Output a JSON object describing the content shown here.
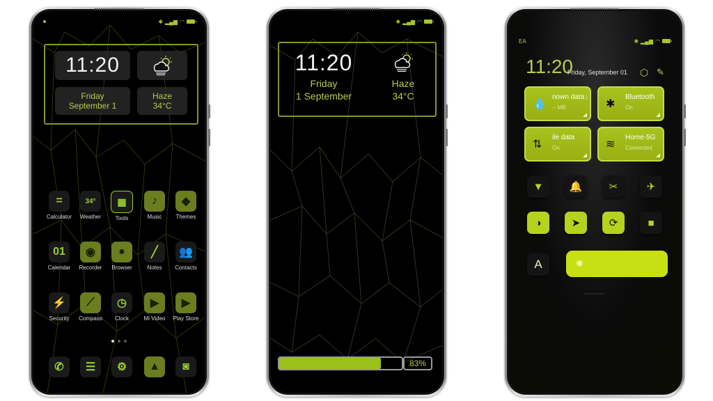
{
  "theme": {
    "accent": "#9bc01a",
    "accent_light": "#b5cc4f",
    "background": "#000000"
  },
  "status_bar": {
    "icons": [
      "bluetooth-icon",
      "signal-icon",
      "wifi-icon",
      "battery-icon"
    ],
    "carrier_left_phone3": "EA"
  },
  "home_screen": {
    "widget": {
      "time": "11:20",
      "day": "Friday",
      "date": "September 1",
      "weather_condition": "Haze",
      "temperature": "34°C",
      "weather_icon": "cloud-sun-icon"
    },
    "apps": [
      {
        "label": "Calculator",
        "icon": "calculator-icon",
        "glyph": "="
      },
      {
        "label": "Weather",
        "icon": "weather-icon",
        "glyph": "34°"
      },
      {
        "label": "Tools",
        "icon": "tools-icon",
        "glyph": "▦"
      },
      {
        "label": "Music",
        "icon": "music-icon",
        "glyph": "♪"
      },
      {
        "label": "Themes",
        "icon": "themes-icon",
        "glyph": "◆"
      },
      {
        "label": "Calendar",
        "icon": "calendar-icon",
        "glyph": "01"
      },
      {
        "label": "Recorder",
        "icon": "recorder-icon",
        "glyph": "◉"
      },
      {
        "label": "Browser",
        "icon": "browser-icon",
        "glyph": "●"
      },
      {
        "label": "Notes",
        "icon": "notes-icon",
        "glyph": "╱"
      },
      {
        "label": "Contacts",
        "icon": "contacts-icon",
        "glyph": "👥"
      },
      {
        "label": "Security",
        "icon": "security-icon",
        "glyph": "⚡"
      },
      {
        "label": "Compass",
        "icon": "compass-icon",
        "glyph": "⟋"
      },
      {
        "label": "Clock",
        "icon": "clock-icon",
        "glyph": "◷"
      },
      {
        "label": "Mi Video",
        "icon": "video-icon",
        "glyph": "▶"
      },
      {
        "label": "Play Store",
        "icon": "play-store-icon",
        "glyph": "▶"
      }
    ],
    "page_count": 3,
    "active_page": 1,
    "dock": [
      {
        "icon": "phone-icon",
        "glyph": "✆"
      },
      {
        "icon": "messages-icon",
        "glyph": "☰"
      },
      {
        "icon": "settings-icon",
        "glyph": "⚙"
      },
      {
        "icon": "gallery-icon",
        "glyph": "▲"
      },
      {
        "icon": "camera-icon",
        "glyph": "◙"
      }
    ]
  },
  "lock_screen": {
    "widget": {
      "time": "11:20",
      "day": "Friday",
      "date": "1 September",
      "weather_condition": "Haze",
      "temperature": "34°C"
    },
    "battery_percent": 83,
    "battery_label": "83%"
  },
  "control_center": {
    "time": "11:20",
    "date": "Friday, September 01",
    "header_icons": [
      "settings-icon",
      "edit-icon"
    ],
    "tiles": [
      {
        "title": "nown data pla",
        "subtitle": "-- MB",
        "icon": "data-drop-icon",
        "glyph": "💧"
      },
      {
        "title": "Bluetooth",
        "subtitle": "On",
        "icon": "bluetooth-icon",
        "glyph": "✱"
      },
      {
        "title": "ile data",
        "subtitle": "On",
        "icon": "mobile-data-icon",
        "glyph": "⇅"
      },
      {
        "title": "Home-5G",
        "subtitle": "Connected",
        "icon": "wifi-icon",
        "glyph": "≋"
      }
    ],
    "toggles": [
      {
        "name": "flashlight",
        "icon": "flashlight-icon",
        "glyph": "▼",
        "on": false
      },
      {
        "name": "ringer",
        "icon": "bell-icon",
        "glyph": "🔔",
        "on": false
      },
      {
        "name": "screenshot",
        "icon": "screenshot-icon",
        "glyph": "✂",
        "on": false
      },
      {
        "name": "airplane",
        "icon": "airplane-icon",
        "glyph": "✈",
        "on": false
      },
      {
        "name": "dark-mode",
        "icon": "contrast-icon",
        "glyph": "◑",
        "on": true
      },
      {
        "name": "location",
        "icon": "location-icon",
        "glyph": "➤",
        "on": true
      },
      {
        "name": "rotation-lock",
        "icon": "rotation-lock-icon",
        "glyph": "⟳",
        "on": true
      },
      {
        "name": "screen-record",
        "icon": "video-camera-icon",
        "glyph": "■",
        "on": false
      }
    ],
    "auto_brightness_label": "A",
    "brightness_level": 1.0
  }
}
